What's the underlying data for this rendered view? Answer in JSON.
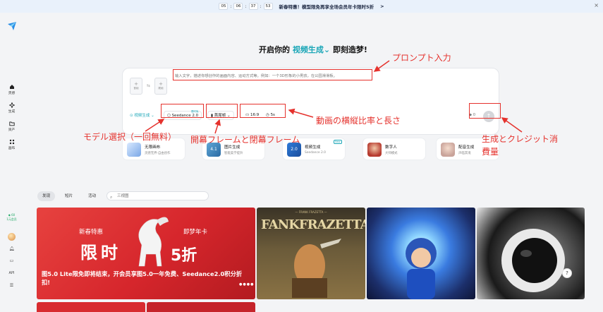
{
  "banner": {
    "countdown": [
      "05",
      "06",
      "37",
      "53"
    ],
    "text": "新春特惠！模型限免再享全场会员年卡限时5折",
    "arrow": ">",
    "close": "×"
  },
  "sidebar": {
    "items": [
      {
        "label": "灵感",
        "icon": "home-icon"
      },
      {
        "label": "生成",
        "icon": "sparkle-icon"
      },
      {
        "label": "资产",
        "icon": "folder-icon"
      },
      {
        "label": "画布",
        "icon": "canvas-icon"
      }
    ],
    "promo_count": "60",
    "promo_label": "1元会员",
    "bottom_api": "API"
  },
  "headline": {
    "prefix": "开启你的",
    "mode": "视频生成",
    "suffix": "即刻造梦!"
  },
  "composer": {
    "first_frame_label": "首帧",
    "last_frame_label": "尾帧",
    "prompt_placeholder": "输入文字，描述你想创作的画面内容、运动方式等。例如：一个3D形象的小男孩，在公园滑滑板。",
    "mode_label": "视频生成",
    "model_label": "Seedance 2.0",
    "model_tag": "限时免",
    "frames_label": "首尾帧",
    "ratio_label": "16:9",
    "duration_label": "5s",
    "credit": "0",
    "generate_icon": "↑"
  },
  "cards": [
    {
      "title": "无限画布",
      "subtitle": "灵感无界·自由创作"
    },
    {
      "title": "图片生成",
      "subtitle": "智能美学提升",
      "badge": "4.1"
    },
    {
      "title": "视频生成",
      "subtitle": "Seedance 2.0",
      "badge": "2.0",
      "tag": "New"
    },
    {
      "title": "数字人",
      "subtitle": "大师模式"
    },
    {
      "title": "配音生成",
      "subtitle": "声临其境"
    }
  ],
  "feed": {
    "tabs": [
      "发现",
      "短片",
      "活动"
    ],
    "search_placeholder": "三视图",
    "hero": {
      "line1": "新春特惠",
      "line2": "限时",
      "line3": "5折",
      "line4": "即梦年卡",
      "caption": "图5.0 Lite限免即将结束，开会员享图5.0一年免费、Seedance2.0积分折扣!"
    },
    "tile2_subtitle": "— FRANK FRAZETTA —",
    "tile2_title": "FANKFRAZETTA"
  },
  "annotations": {
    "prompt": "プロンプト入力",
    "ratio": "動画の横縦比率と長さ",
    "model": "モデル選択（一回無料）",
    "frames": "開幕フレームと閉幕フレーム",
    "generate": "生成とクレジット消",
    "generate2": "費量"
  },
  "colors": {
    "accent": "#1aa6b7",
    "annotation": "#e5322d",
    "hero_red": "#d6262c"
  }
}
